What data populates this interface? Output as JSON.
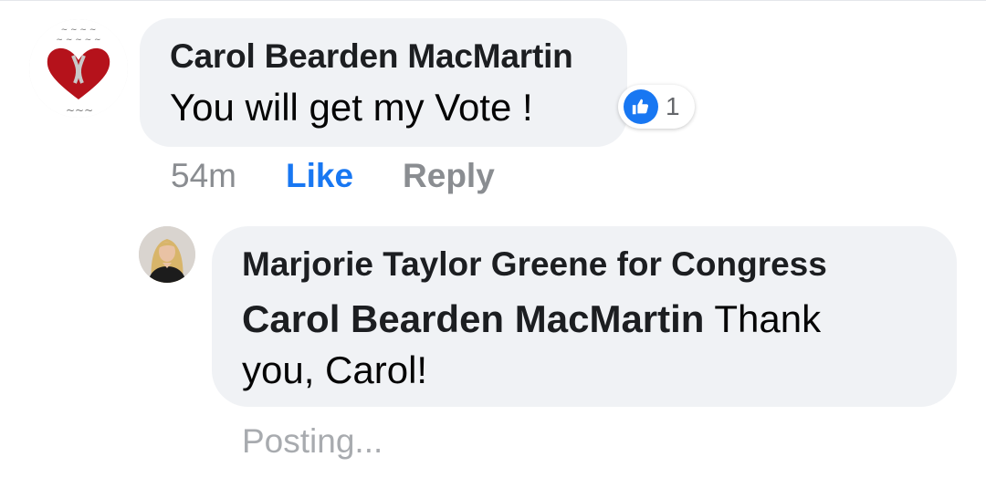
{
  "comment": {
    "author": "Carol Bearden MacMartin",
    "text": "You will get my Vote !",
    "reactions": {
      "type": "like",
      "icon": "thumbs-up-icon",
      "count": "1",
      "color": "#1877f2"
    },
    "timestamp": "54m",
    "like_label": "Like",
    "reply_label": "Reply"
  },
  "reply": {
    "author": "Marjorie Taylor Greene for Congress",
    "mention": "Carol Bearden MacMartin",
    "text_line1": " Thank",
    "text_line2": "you, Carol!",
    "status": "Posting..."
  }
}
